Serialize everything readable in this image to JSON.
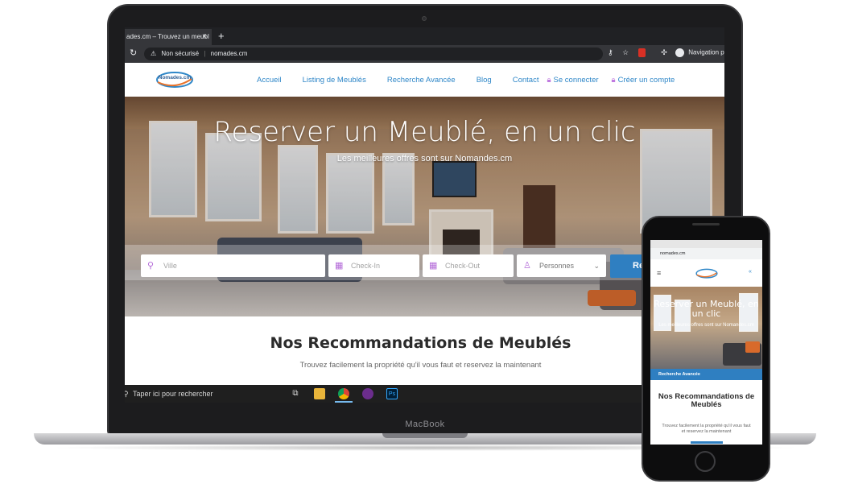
{
  "browser": {
    "tab_title": "ades.cm – Trouvez un meubl",
    "tab_close": "×",
    "new_tab": "+",
    "address_warning": "Non sécurisé",
    "address_url": "nomades.cm",
    "profile_label": "Navigation pr"
  },
  "site": {
    "logo_text": "Nomades.cm",
    "nav": [
      {
        "label": "Accueil"
      },
      {
        "label": "Listing de Meublés"
      },
      {
        "label": "Recherche Avancée"
      },
      {
        "label": "Blog"
      },
      {
        "label": "Contact"
      },
      {
        "label": "Se connecter"
      },
      {
        "label": "Créer un compte"
      }
    ],
    "hero": {
      "title": "Reserver un Meublé, en un clic",
      "subtitle": "Les meilleures offres sont sur Nomandes.cm"
    },
    "search": {
      "ville_placeholder": "Ville",
      "checkin_placeholder": "Check-In",
      "checkout_placeholder": "Check-Out",
      "persons_label": "Personnes",
      "button_label": "Re"
    },
    "section": {
      "title": "Nos Recommandations de Meublés",
      "subtitle": "Trouvez facilement la propriété qu'il vous faut et reservez la maintenant"
    }
  },
  "taskbar": {
    "search_text": "Taper ici pour rechercher",
    "apps": [
      "task-view",
      "file-explorer",
      "chrome",
      "app",
      "photoshop"
    ]
  },
  "device": {
    "brand_label": "MacBook"
  },
  "phone": {
    "url": "nomades.cm",
    "hero_title": "Reserver un Meublé, en un clic",
    "hero_subtitle": "Les meilleures offres sont sur Nomandes.cm",
    "bar_label": "Recherche Avancée",
    "section_title": "Nos Recommandations de Meublés",
    "section_subtitle": "Trouvez facilement la propriété qu'il vous faut et reservez la maintenant"
  },
  "colors": {
    "accent": "#2f7fc1",
    "nav_link": "#2f87c8",
    "icon_purple": "#b36ad8"
  }
}
